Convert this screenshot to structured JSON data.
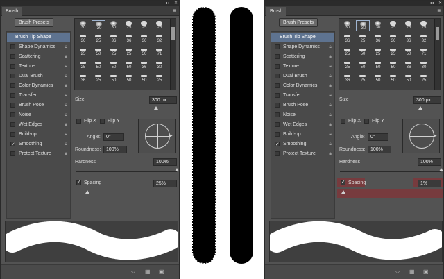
{
  "left_panel": {
    "tab": "Brush",
    "presets_button": "Brush Presets",
    "options": [
      {
        "label": "Brush Tip Shape",
        "checked": false,
        "active": true,
        "lock": false
      },
      {
        "label": "Shape Dynamics",
        "checked": false,
        "active": false,
        "lock": true
      },
      {
        "label": "Scattering",
        "checked": false,
        "active": false,
        "lock": true
      },
      {
        "label": "Texture",
        "checked": false,
        "active": false,
        "lock": true
      },
      {
        "label": "Dual Brush",
        "checked": false,
        "active": false,
        "lock": true
      },
      {
        "label": "Color Dynamics",
        "checked": false,
        "active": false,
        "lock": true
      },
      {
        "label": "Transfer",
        "checked": false,
        "active": false,
        "lock": true
      },
      {
        "label": "Brush Pose",
        "checked": false,
        "active": false,
        "lock": true
      },
      {
        "label": "Noise",
        "checked": false,
        "active": false,
        "lock": true
      },
      {
        "label": "Wet Edges",
        "checked": false,
        "active": false,
        "lock": true
      },
      {
        "label": "Build-up",
        "checked": false,
        "active": false,
        "lock": true
      },
      {
        "label": "Smoothing",
        "checked": true,
        "active": false,
        "lock": true
      },
      {
        "label": "Protect Texture",
        "checked": false,
        "active": false,
        "lock": true
      }
    ],
    "size_label": "Size",
    "size_value": "300 px",
    "flip_x": "Flip X",
    "flip_y": "Flip Y",
    "angle_label": "Angle:",
    "angle_value": "0°",
    "roundness_label": "Roundness:",
    "roundness_value": "100%",
    "hardness_label": "Hardness",
    "hardness_value": "100%",
    "spacing_label": "Spacing",
    "spacing_value": "25%"
  },
  "right_panel": {
    "tab": "Brush",
    "presets_button": "Brush Presets",
    "size_label": "Size",
    "size_value": "300 px",
    "flip_x": "Flip X",
    "flip_y": "Flip Y",
    "angle_label": "Angle:",
    "angle_value": "0°",
    "roundness_label": "Roundness:",
    "roundness_value": "100%",
    "hardness_label": "Hardness",
    "hardness_value": "100%",
    "spacing_label": "Spacing",
    "spacing_value": "1%"
  },
  "brush_grid_numbers": [
    [
      "30",
      "30",
      "30",
      "25",
      "25",
      "25"
    ],
    [
      "36",
      "25",
      "36",
      "36",
      "36",
      "32"
    ],
    [
      "25",
      "50",
      "25",
      "25",
      "50",
      "71"
    ],
    [
      "25",
      "50",
      "50",
      "50",
      "36",
      "30"
    ],
    [
      "36",
      "25",
      "50",
      "50",
      "50",
      "25"
    ]
  ],
  "colors": {
    "panel_bg": "#535353",
    "selected_option": "#5e7390",
    "highlight": "#96282d"
  }
}
